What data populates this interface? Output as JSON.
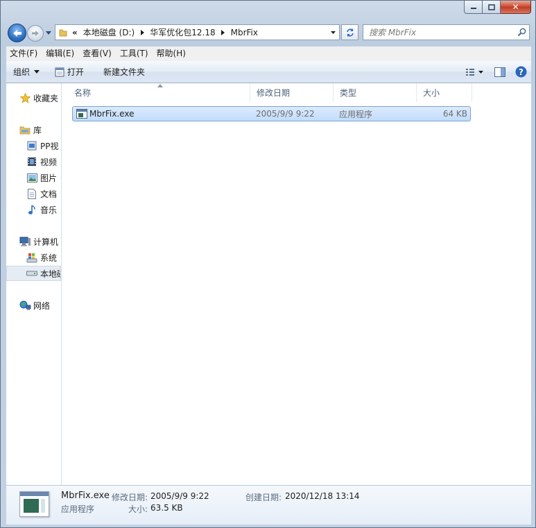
{
  "window": {
    "close_glyph": "✕"
  },
  "address": {
    "overflow": "«",
    "segments": [
      "本地磁盘 (D:)",
      "华军优化包12.18",
      "MbrFix"
    ]
  },
  "search": {
    "placeholder": "搜索 MbrFix"
  },
  "menu": {
    "items": [
      "文件(F)",
      "编辑(E)",
      "查看(V)",
      "工具(T)",
      "帮助(H)"
    ]
  },
  "toolbar": {
    "organize": "组织",
    "open": "打开",
    "new_folder": "新建文件夹"
  },
  "nav": {
    "favorites": "收藏夹",
    "library": "库",
    "library_items": [
      "PP视",
      "视频",
      "图片",
      "文档",
      "音乐"
    ],
    "computer": "计算机",
    "computer_items": [
      "系统",
      "本地磁"
    ],
    "network": "网络"
  },
  "columns": [
    "名称",
    "修改日期",
    "类型",
    "大小"
  ],
  "files": [
    {
      "name": "MbrFix.exe",
      "modified": "2005/9/9 9:22",
      "type": "应用程序",
      "size": "64 KB"
    }
  ],
  "details": {
    "name": "MbrFix.exe",
    "type": "应用程序",
    "modified_label": "修改日期:",
    "modified_value": "2005/9/9 9:22",
    "created_label": "创建日期:",
    "created_value": "2020/12/18 13:14",
    "size_label": "大小:",
    "size_value": "63.5 KB"
  },
  "colors": {
    "selection": "#cce4fc",
    "selection_border": "#7da2ce",
    "accent": "#1e395b"
  }
}
